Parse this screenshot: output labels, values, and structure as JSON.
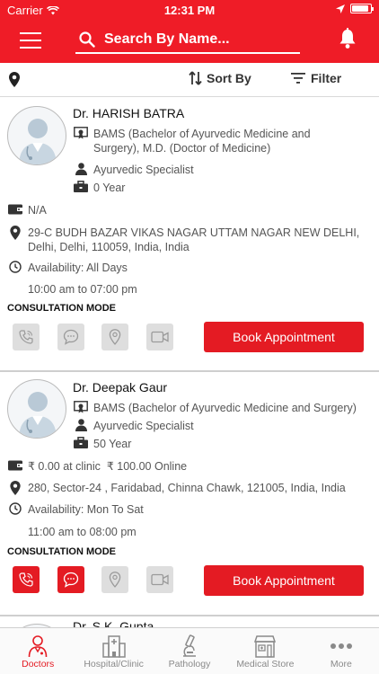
{
  "status_bar": {
    "carrier": "Carrier",
    "time": "12:31 PM",
    "battery_level": 0.9
  },
  "header": {
    "search_placeholder": "Search By Name...",
    "icons": [
      "menu-icon",
      "search-icon",
      "bell-icon"
    ]
  },
  "toolbar": {
    "sort_label": "Sort By",
    "filter_label": "Filter"
  },
  "doctors": [
    {
      "name": "Dr. HARISH BATRA",
      "qualification": "BAMS (Bachelor of Ayurvedic Medicine and Surgery), M.D. (Doctor of Medicine)",
      "qualification_lines": [
        "BAMS (Bachelor of Ayurvedic Medicine and",
        "Surgery), M.D. (Doctor of Medicine)"
      ],
      "specialty": "Ayurvedic Specialist",
      "experience": "0 Year",
      "fee": "N/A",
      "address_lines": [
        "29-C BUDH BAZAR VIKAS NAGAR UTTAM NAGAR NEW DELHI,",
        "Delhi, Delhi, 110059, India, India"
      ],
      "availability": "Availability: All Days",
      "hours": "10:00 am to 07:00 pm",
      "consultation_label": "CONSULTATION MODE",
      "modes": {
        "phone": false,
        "chat": false,
        "in_clinic": false,
        "video": false
      },
      "book_label": "Book Appointment"
    },
    {
      "name": "Dr. Deepak Gaur",
      "qualification": "BAMS (Bachelor of Ayurvedic Medicine and Surgery)",
      "specialty": "Ayurvedic Specialist",
      "experience": "50 Year",
      "fee": "₹ 0.00 at clinic  ₹ 100.00 Online",
      "address": "280, Sector-24 , Faridabad, Chinna Chawk, 121005, India, India",
      "availability": "Availability: Mon To Sat",
      "hours": "11:00 am to 08:00 pm",
      "consultation_label": "CONSULTATION MODE",
      "modes": {
        "phone": true,
        "chat": true,
        "in_clinic": false,
        "video": false
      },
      "book_label": "Book Appointment"
    },
    {
      "name": "Dr. S.K. Gupta"
    }
  ],
  "tabs": [
    {
      "label": "Doctors",
      "active": true
    },
    {
      "label": "Hospital/Clinic",
      "active": false
    },
    {
      "label": "Pathology",
      "active": false
    },
    {
      "label": "Medical Store",
      "active": false
    },
    {
      "label": "More",
      "active": false
    }
  ],
  "colors": {
    "brand_red": "#ef1c27",
    "button_red": "#e41b23",
    "inactive_gray": "#dedede"
  }
}
